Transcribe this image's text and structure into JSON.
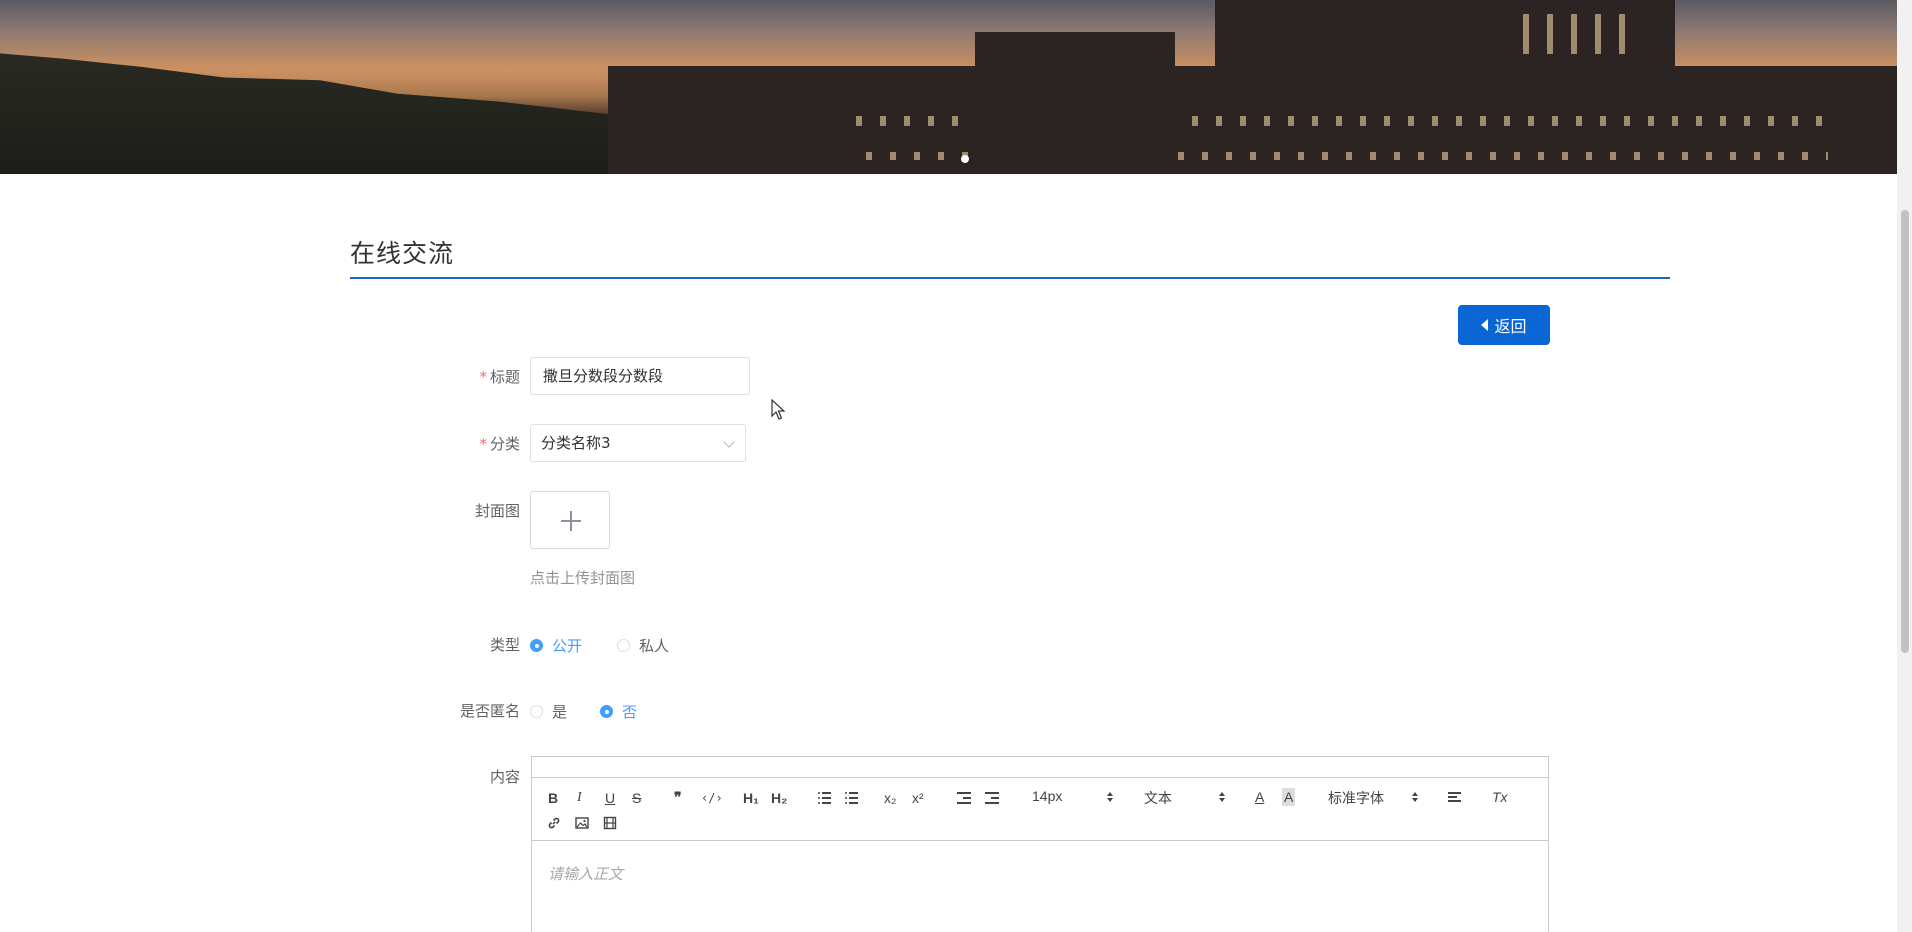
{
  "page": {
    "section_title": "在线交流",
    "back_button": "返回"
  },
  "form": {
    "title": {
      "label": "标题",
      "value": "撒旦分数段分数段"
    },
    "category": {
      "label": "分类",
      "value": "分类名称3"
    },
    "cover": {
      "label": "封面图",
      "hint": "点击上传封面图"
    },
    "type": {
      "label": "类型",
      "options": [
        "公开",
        "私人"
      ],
      "selected": "公开"
    },
    "anonymous": {
      "label": "是否匿名",
      "options": [
        "是",
        "否"
      ],
      "selected": "否"
    },
    "content": {
      "label": "内容",
      "placeholder": "请输入正文"
    }
  },
  "editor_toolbar": {
    "bold": "B",
    "italic": "I",
    "underline": "U",
    "strike": "S",
    "quote": "❞",
    "code": "‹/›",
    "h1": "H₁",
    "h2": "H₂",
    "sub": "x₂",
    "sup": "x²",
    "size": "14px",
    "header": "文本",
    "font": "标准字体",
    "color": "A",
    "clean": "Tx"
  },
  "colors": {
    "accent": "#0a66d3",
    "radio_active": "#409eff",
    "required": "#f56c6c"
  }
}
